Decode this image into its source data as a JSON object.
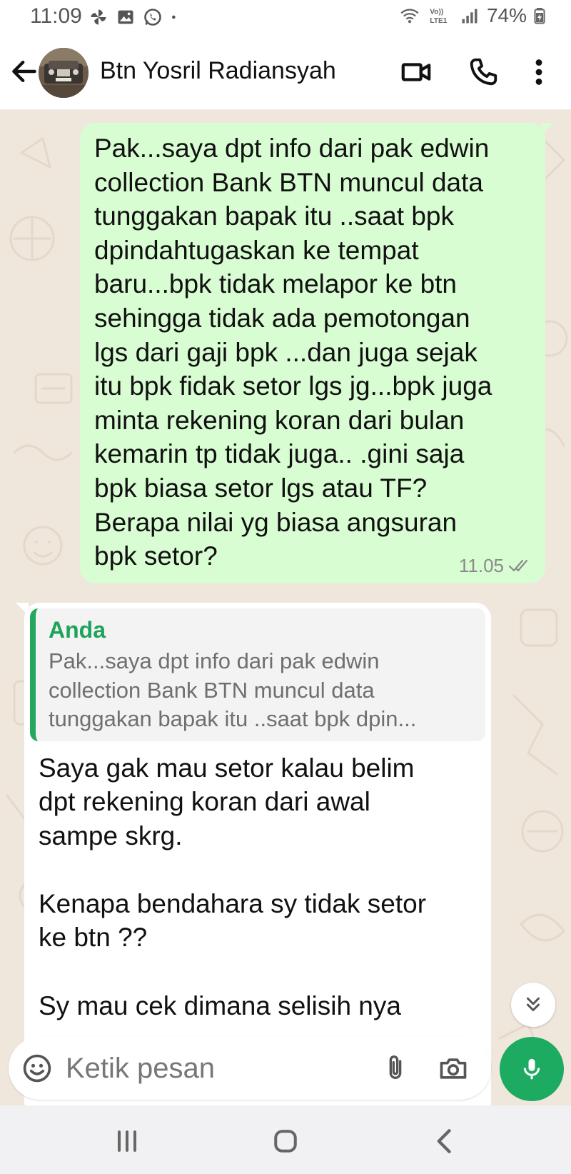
{
  "status_bar": {
    "time": "11:09",
    "battery": "74%",
    "left_icons": [
      "pinwheel-icon",
      "gallery-icon",
      "whatsapp-icon",
      "dot-icon"
    ],
    "right_icons": [
      "wifi-icon",
      "volte-icon",
      "signal-icon",
      "battery-icon"
    ]
  },
  "header": {
    "contact_name": "Btn Yosril Radiansyah",
    "icons": [
      "back-arrow-icon",
      "video-call-icon",
      "voice-call-icon",
      "more-vert-icon"
    ]
  },
  "messages": [
    {
      "direction": "outgoing",
      "text": "Pak...saya dpt info dari pak edwin\ncollection Bank BTN muncul data\ntunggakan bapak itu ..saat bpk\ndpindahtugaskan ke tempat\nbaru...bpk tidak melapor ke btn\nsehingga tidak ada pemotongan\nlgs dari gaji bpk ...dan juga sejak\nitu bpk fidak setor lgs jg...bpk juga\nminta rekening koran dari bulan\nkemarin tp tidak juga.. .gini saja\nbpk biasa setor lgs atau TF?\nBerapa nilai yg biasa angsuran\nbpk setor?",
      "time": "11.05",
      "status": "read"
    },
    {
      "direction": "incoming",
      "quote_author": "Anda",
      "quote_text": "Pak...saya dpt info dari pak edwin\ncollection Bank BTN muncul data\ntunggakan bapak itu ..saat bpk dpin...",
      "text": "Saya gak mau setor kalau belim\ndpt rekening koran dari awal\nsampe skrg.\n\nKenapa bendahara sy tidak setor\nke btn ??\n\nSy mau cek dimana selisih nya"
    }
  ],
  "input": {
    "placeholder": "Ketik pesan"
  },
  "colors": {
    "outgoing_bubble": "#d9fdd3",
    "incoming_bubble": "#ffffff",
    "wallpaper": "#efe7dc",
    "accent_green": "#1daa61",
    "quote_author": "#1fa35b"
  }
}
